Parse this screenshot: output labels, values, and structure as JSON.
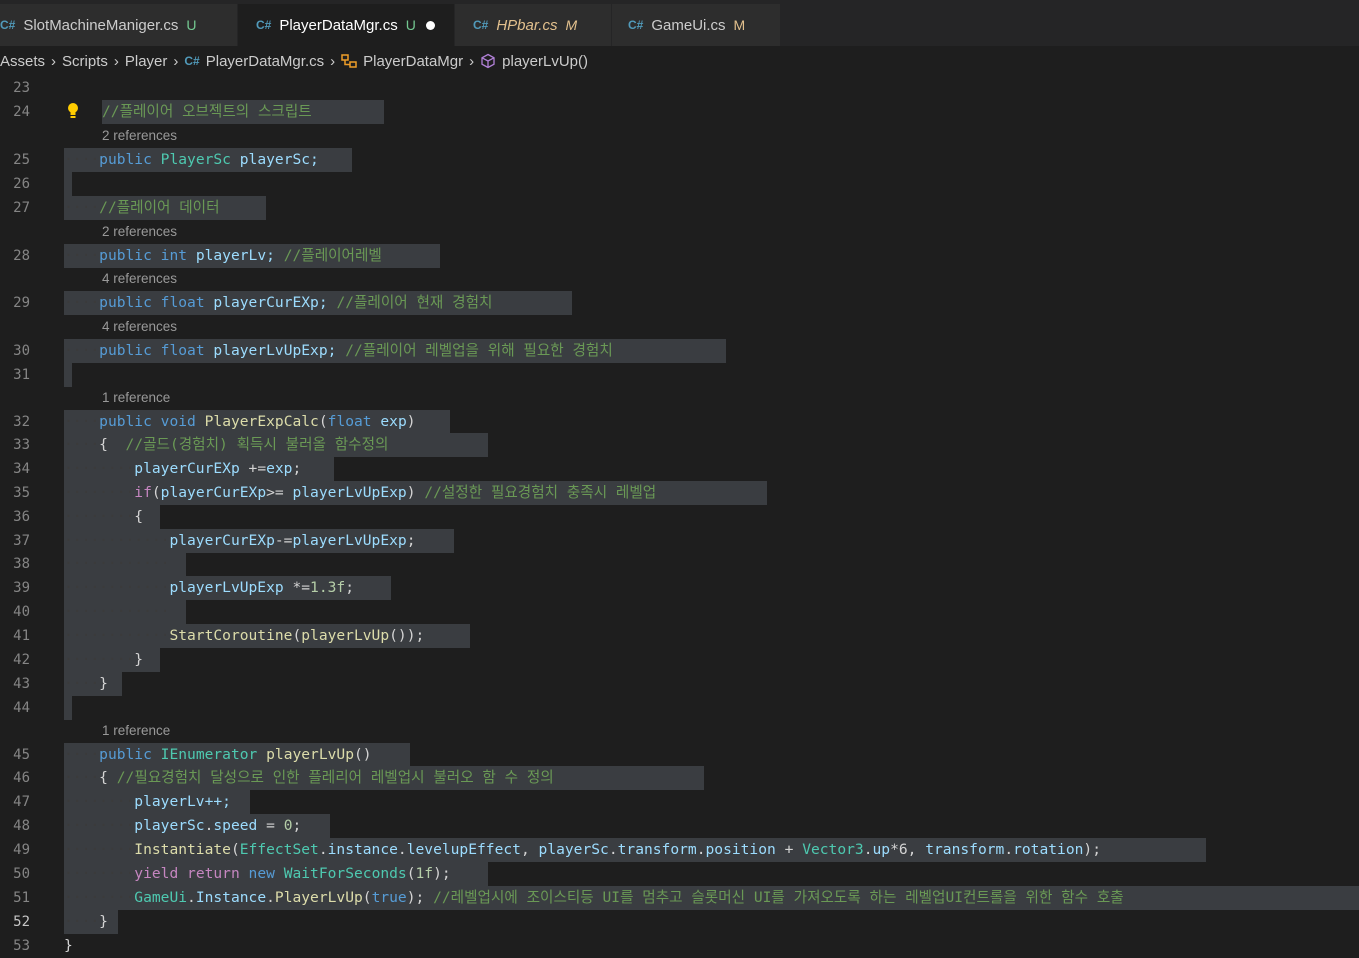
{
  "tabs": [
    {
      "label": "SlotMachineManiger.cs",
      "status": "U"
    },
    {
      "label": "PlayerDataMgr.cs",
      "status": "U"
    },
    {
      "label": "HPbar.cs",
      "status": "M"
    },
    {
      "label": "GameUi.cs",
      "status": "M"
    }
  ],
  "breadcrumb": [
    "Assets",
    "Scripts",
    "Player",
    "PlayerDataMgr.cs",
    "PlayerDataMgr",
    "playerLvUp()"
  ],
  "icons": {
    "csharp": "C#",
    "class": "class-icon",
    "method": "method-icon",
    "lightbulb": "lightbulb-icon"
  },
  "codelens": {
    "l24": "2 references",
    "l27": "2 references",
    "l28": "4 references",
    "l29": "4 references",
    "l31": "1 reference",
    "l44": "1 reference"
  },
  "line_numbers": [
    "23",
    "24",
    "25",
    "26",
    "27",
    "28",
    "29",
    "30",
    "31",
    "32",
    "33",
    "34",
    "35",
    "36",
    "37",
    "38",
    "39",
    "40",
    "41",
    "42",
    "43",
    "44",
    "45",
    "46",
    "47",
    "48",
    "49",
    "50",
    "51",
    "52",
    "53"
  ],
  "code": {
    "c24": "//플레이어 오브젝트의 스크립트",
    "c25a": "public",
    "c25b": "PlayerSc",
    "c25c": "playerSc;",
    "c27": "//플레이어 데이터",
    "c28a": "public",
    "c28b": "int",
    "c28c": "playerLv;",
    "c28d": "//플레이어레벨",
    "c29a": "public",
    "c29b": "float",
    "c29c": "playerCurEXp;",
    "c29d": "//플레이어 현재 경험치",
    "c30a": "public",
    "c30b": "float",
    "c30c": "playerLvUpExp;",
    "c30d": "//플레이어 레벨업을 위해 필요한 경험치",
    "c32a": "public",
    "c32b": "void",
    "c32c": "PlayerExpCalc",
    "c32d": "(",
    "c32e": "float",
    "c32f": "exp",
    ")": ")",
    "c33a": "{",
    "c33b": "//골드(경험치) 획득시 불러올 함수정의",
    "c34a": "playerCurEXp",
    "c34b": "+=",
    "c34c": "exp",
    ";": ";",
    "c35a": "if",
    "c35b": "(",
    "c35c": "playerCurEXp",
    ">=": ">=",
    "c35d": "playerLvUpExp",
    "c35e": "//설정한 필요경험치 충족시 레벨업",
    "c36": "{",
    "c37a": "playerCurEXp",
    "c37b": "-=",
    "c37c": "playerLvUpExp",
    "c39a": "playerLvUpExp",
    "c39b": "*=",
    "c39c": "1.3f",
    "c41a": "StartCoroutine",
    "c41b": "playerLvUp",
    "c42": "}",
    "c43": "}",
    "c45a": "public",
    "c45b": "IEnumerator",
    "c45c": "playerLvUp",
    "c46a": "{",
    "c46b": "//필요경험치 달성으로 인한 플레리어 레벨업시 불러오 함 수 정의",
    "c47": "playerLv++;",
    "c48a": "playerSc",
    "c48b": "speed",
    "c48c": "=",
    "c48d": "0",
    "c49a": "Instantiate",
    "c49b": "EffectSet",
    "c49c": "instance",
    "c49d": "levelupEffect",
    "c49e": "playerSc",
    "c49f": "transform",
    "c49g": "position",
    "c49h": "+",
    "c49i": "Vector3",
    "c49j": "up",
    "c49k": "*6",
    "c49l": "transform",
    "c49m": "rotation",
    "c50a": "yield",
    "c50b": "return",
    "c50c": "new",
    "c50d": "WaitForSeconds",
    "c50e": "1f",
    "c51a": "GameUi",
    "c51b": "Instance",
    "c51c": "PlayerLvUp",
    "c51d": "true",
    "c51e": "//레벨업시에 조이스티등 UI를 멈추고 슬롯머신 UI를 가져오도록 하는 레벨업UI컨트롤을 위한 함수 호출",
    "c52": "}",
    "c53": "}"
  },
  "colors": {
    "keyword": "#569cd6",
    "type": "#4ec9b0",
    "function": "#dcdcaa",
    "variable": "#9cdcfe",
    "comment": "#6a9955",
    "number": "#b5cea8",
    "control": "#c586c0",
    "selection": "#3a3d41"
  }
}
